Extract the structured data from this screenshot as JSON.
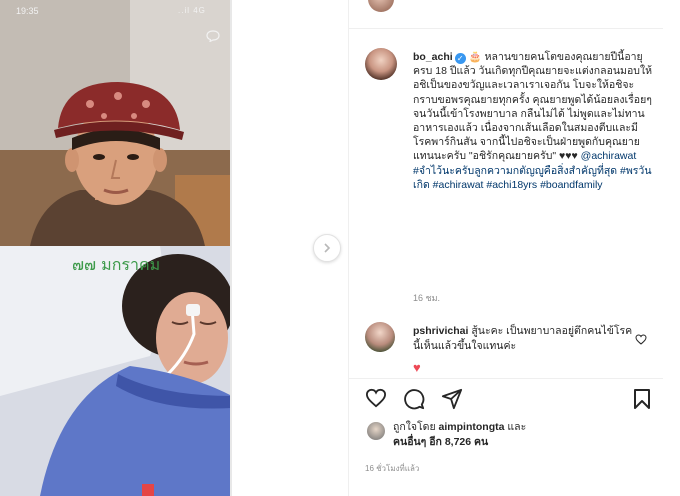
{
  "phone": {
    "time": "19:35",
    "status": "..il 4G"
  },
  "media": {
    "overlay_text": "๗๗ มกราคม"
  },
  "post": {
    "username": "bo_achi",
    "caption_prefix": "🎂 หลานขายคนโตของคุณยายปีนี้อายุครบ 18 ปีแล้ว วันเกิดทุกปีคุณยายจะแต่งกลอนมอบให้อชิเป็นของขวัญและเวลาเราเจอกัน โบจะให้อชิจะกราบขอพรคุณยายทุกครั้ง คุณยายพูดได้น้อยลงเรื่อยๆจนวันนี้เข้าโรงพยาบาล กลืนไม่ได้ ไม่พูดและไม่ทานอาหารเองแล้ว เนื่องจากเส้นเลือดในสมองตีบและมีโรคพาร์กินสัน จากนี้ไปอชิจะเป็นฝ่ายพูดกับคุณยายแทนนะครับ \"อชิรักคุณยายครับ\" ♥♥♥",
    "caption_tags": "@achirawat #จำไว้นะครับลูกความกตัญญูคือสิ่งสำคัญที่สุด #พรวันเกิด #achirawat #achi18yrs #boandfamily",
    "time_ago": "16 ชม."
  },
  "comment": {
    "username": "pshrivichai",
    "text": "สู้นะคะ เป็นพยาบาลอยู่ตึกคนไข้โรคนี้เห็นแล้วขึ้นใจแทนค่ะ",
    "reply_emoji": "♥"
  },
  "likes": {
    "prefix": "ถูกใจโดย",
    "liker": "aimpintongta",
    "mid": "และ",
    "others_label": "คนอื่นๆ อีก 8,726 คน"
  },
  "post_time": "16 ชั่วโมงที่แล้ว",
  "icons": {
    "like": "heart-icon",
    "comment": "comment-icon",
    "share": "send-icon",
    "save": "bookmark-icon",
    "next": "chevron-right-icon"
  },
  "colors": {
    "tag": "#00376b",
    "verified": "#3897f0",
    "heart": "#ed4956",
    "muted": "#8e8e8e"
  }
}
